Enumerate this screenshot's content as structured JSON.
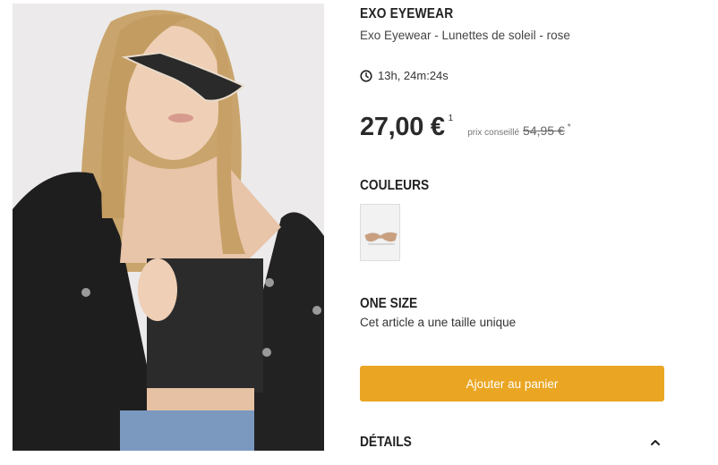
{
  "product": {
    "brand": "EXO EYEWEAR",
    "name": "Exo Eyewear - Lunettes de soleil - rose",
    "countdown": "13h, 24m:24s",
    "price": "27,00 €",
    "price_footnote": "1",
    "recommended_label": "prix conseillé",
    "recommended_price": "54,95 €",
    "recommended_footnote": "*"
  },
  "colors": {
    "title": "COULEURS"
  },
  "size": {
    "title": "ONE SIZE",
    "note": "Cet article a une taille unique"
  },
  "actions": {
    "add_to_cart": "Ajouter au panier"
  },
  "details": {
    "title": "DÉTAILS"
  },
  "icons": {
    "timer": "clock-icon",
    "details_toggle": "chevron-up-icon"
  },
  "colors_theme": {
    "accent": "#eaa623",
    "text": "#222222"
  }
}
